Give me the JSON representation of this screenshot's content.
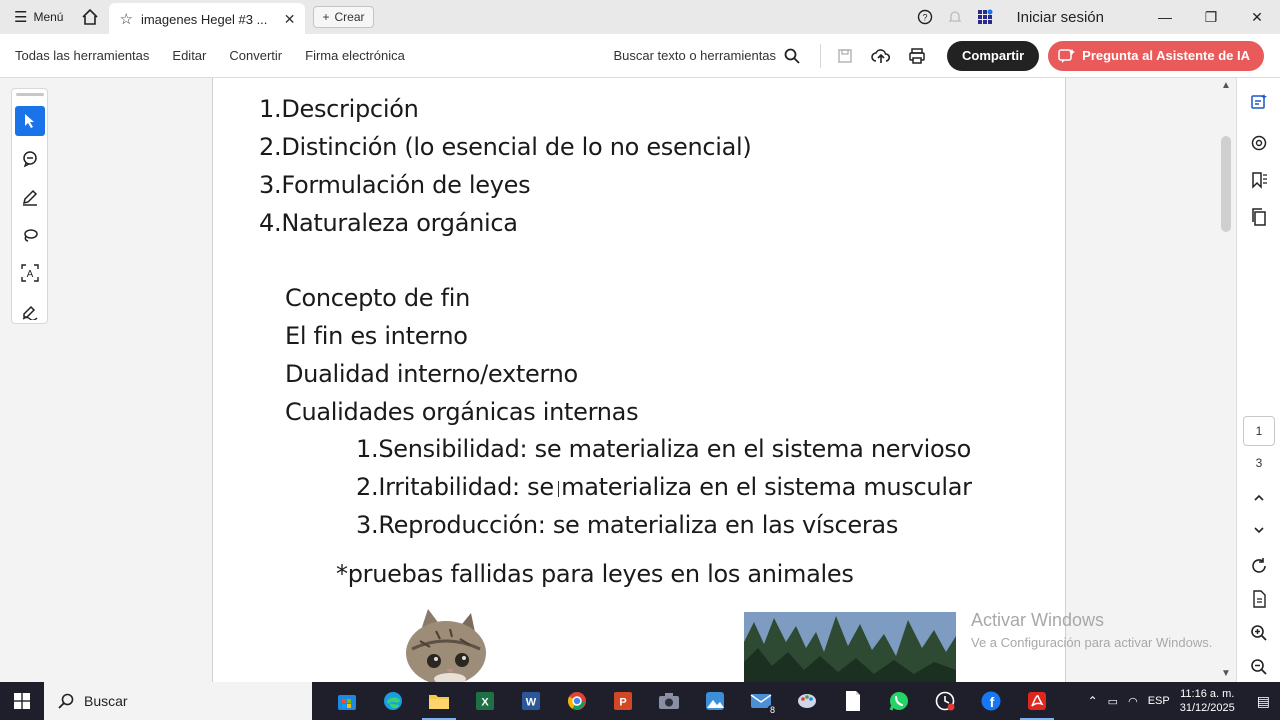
{
  "tabbar": {
    "menu_label": "Menú",
    "tab_title": "imagenes Hegel #3 ...",
    "create_label": "Crear",
    "signin_label": "Iniciar sesión"
  },
  "toolbar": {
    "items": [
      "Todas las herramientas",
      "Editar",
      "Convertir",
      "Firma electrónica"
    ],
    "search_label": "Buscar texto o herramientas",
    "share_label": "Compartir",
    "ai_label": "Pregunta al Asistente de IA"
  },
  "document": {
    "list1": [
      {
        "num": "1.",
        "text": "Descripción"
      },
      {
        "num": "2.",
        "text": "Distinción (lo esencial de lo no esencial)"
      },
      {
        "num": "3.",
        "text": "Formulación de leyes"
      },
      {
        "num": "4.",
        "text": "Naturaleza orgánica"
      }
    ],
    "plain_lines": [
      "Concepto de fin",
      "El fin es interno",
      "Dualidad interno/externo",
      "Cualidades orgánicas internas"
    ],
    "list2": [
      {
        "num": "1.",
        "text": "Sensibilidad: se materializa en el sistema nervioso"
      },
      {
        "num": "2.",
        "text": "Irritabilidad: se materializa en el sistema muscular"
      },
      {
        "num": "3.",
        "text": "Reproducción: se materializa en las vísceras"
      }
    ],
    "note": "*pruebas fallidas para leyes en los animales"
  },
  "watermark": {
    "line1": "Activar Windows",
    "line2": "Ve a Configuración para activar Windows."
  },
  "pager": {
    "current": "1",
    "total": "3"
  },
  "taskbar": {
    "search_label": "Buscar",
    "mail_badge": "8",
    "language": "ESP",
    "time": "11:16 a. m.",
    "date": "31/12/2025"
  },
  "colors": {
    "accent_blue": "#1a73e8",
    "ai_button": "#e95a5a",
    "share_button": "#222222",
    "taskbar": "#1f1f2b"
  }
}
